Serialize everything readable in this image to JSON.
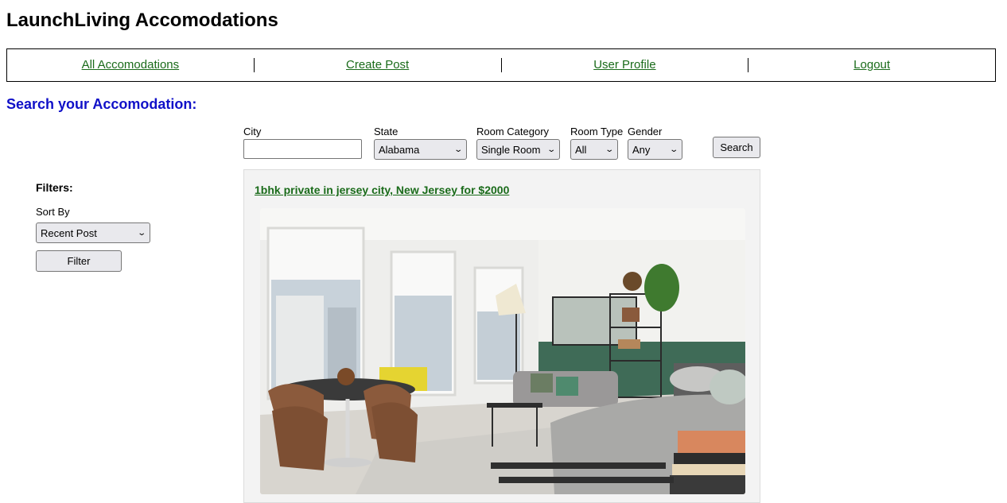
{
  "app": {
    "title": "LaunchLiving Accomodations"
  },
  "nav": {
    "items": [
      {
        "label": "All Accomodations"
      },
      {
        "label": "Create Post"
      },
      {
        "label": "User Profile"
      },
      {
        "label": "Logout"
      }
    ]
  },
  "search": {
    "heading": "Search your Accomodation:",
    "city": {
      "label": "City",
      "value": ""
    },
    "state": {
      "label": "State",
      "selected": "Alabama"
    },
    "room_category": {
      "label": "Room Category",
      "selected": "Single Room"
    },
    "room_type": {
      "label": "Room Type",
      "selected": "All"
    },
    "gender": {
      "label": "Gender",
      "selected": "Any"
    },
    "button_label": "Search"
  },
  "filters": {
    "heading": "Filters:",
    "sort_label": "Sort By",
    "sort_selected": "Recent Post",
    "button_label": "Filter"
  },
  "listing": {
    "title": "1bhk private in jersey city, New Jersey for $2000",
    "image_icon": "apartment-photo"
  },
  "colors": {
    "link": "#1a6b1a",
    "heading": "#1010c8",
    "card_bg": "#f3f3f3",
    "button_bg": "#e9e9ed"
  }
}
